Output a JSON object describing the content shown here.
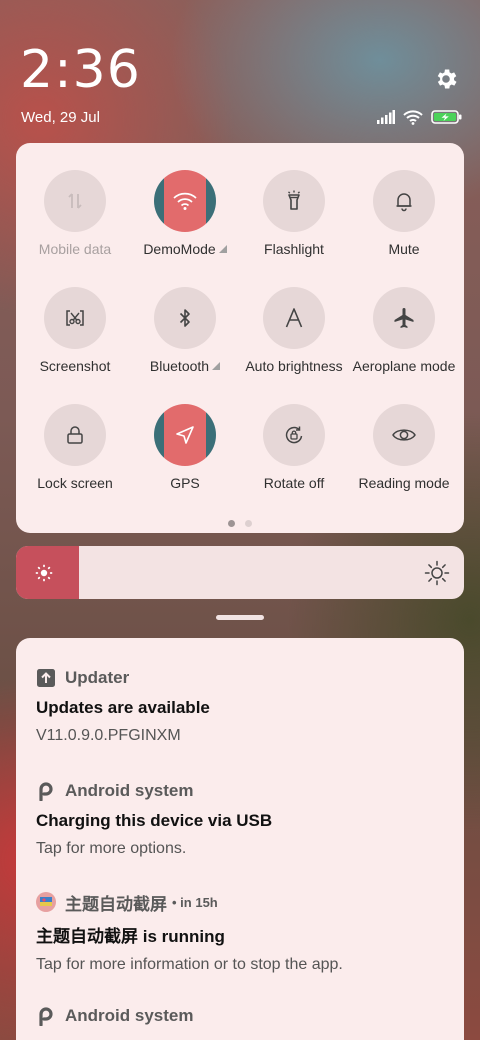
{
  "status": {
    "time": "2:36",
    "date": "Wed, 29 Jul",
    "icons": [
      "signal-icon",
      "wifi-icon",
      "battery-charging-icon"
    ],
    "settings_icon": "gear-icon"
  },
  "quick_settings": {
    "tiles": [
      {
        "label": "Mobile data",
        "icon": "mobile-data-icon",
        "active": false,
        "dimmed": true,
        "expandable": false
      },
      {
        "label": "DemoMode",
        "icon": "wifi-icon",
        "active": true,
        "dimmed": false,
        "expandable": true
      },
      {
        "label": "Flashlight",
        "icon": "flashlight-icon",
        "active": false,
        "dimmed": false,
        "expandable": false
      },
      {
        "label": "Mute",
        "icon": "bell-icon",
        "active": false,
        "dimmed": false,
        "expandable": false
      },
      {
        "label": "Screenshot",
        "icon": "screenshot-icon",
        "active": false,
        "dimmed": false,
        "expandable": false
      },
      {
        "label": "Bluetooth",
        "icon": "bluetooth-icon",
        "active": false,
        "dimmed": false,
        "expandable": true
      },
      {
        "label": "Auto brightness",
        "icon": "auto-brightness-icon",
        "active": false,
        "dimmed": false,
        "expandable": false
      },
      {
        "label": "Aeroplane mode",
        "icon": "airplane-icon",
        "active": false,
        "dimmed": false,
        "expandable": false
      },
      {
        "label": "Lock screen",
        "icon": "lock-icon",
        "active": false,
        "dimmed": false,
        "expandable": false
      },
      {
        "label": "GPS",
        "icon": "location-arrow-icon",
        "active": true,
        "dimmed": false,
        "expandable": false
      },
      {
        "label": "Rotate off",
        "icon": "rotate-lock-icon",
        "active": false,
        "dimmed": false,
        "expandable": false
      },
      {
        "label": "Reading mode",
        "icon": "eye-icon",
        "active": false,
        "dimmed": false,
        "expandable": false
      }
    ],
    "page_count": 2,
    "current_page": 1
  },
  "brightness": {
    "level": 0.14,
    "accent": "#c6505c"
  },
  "notifications": [
    {
      "app": "Updater",
      "icon": "update-arrow-icon",
      "time": "",
      "title": "Updates are available",
      "body": "V11.0.9.0.PFGINXM"
    },
    {
      "app": "Android system",
      "icon": "android-system-icon",
      "time": "",
      "title": "Charging this device via USB",
      "body": "Tap for more options."
    },
    {
      "app": "主题自动截屏",
      "icon": "app-thumbnail-icon",
      "time": "in 15h",
      "title": "主题自动截屏 is running",
      "body": "Tap for more information or to stop the app."
    },
    {
      "app": "Android system",
      "icon": "android-system-icon",
      "time": "",
      "title": "",
      "body": ""
    }
  ]
}
